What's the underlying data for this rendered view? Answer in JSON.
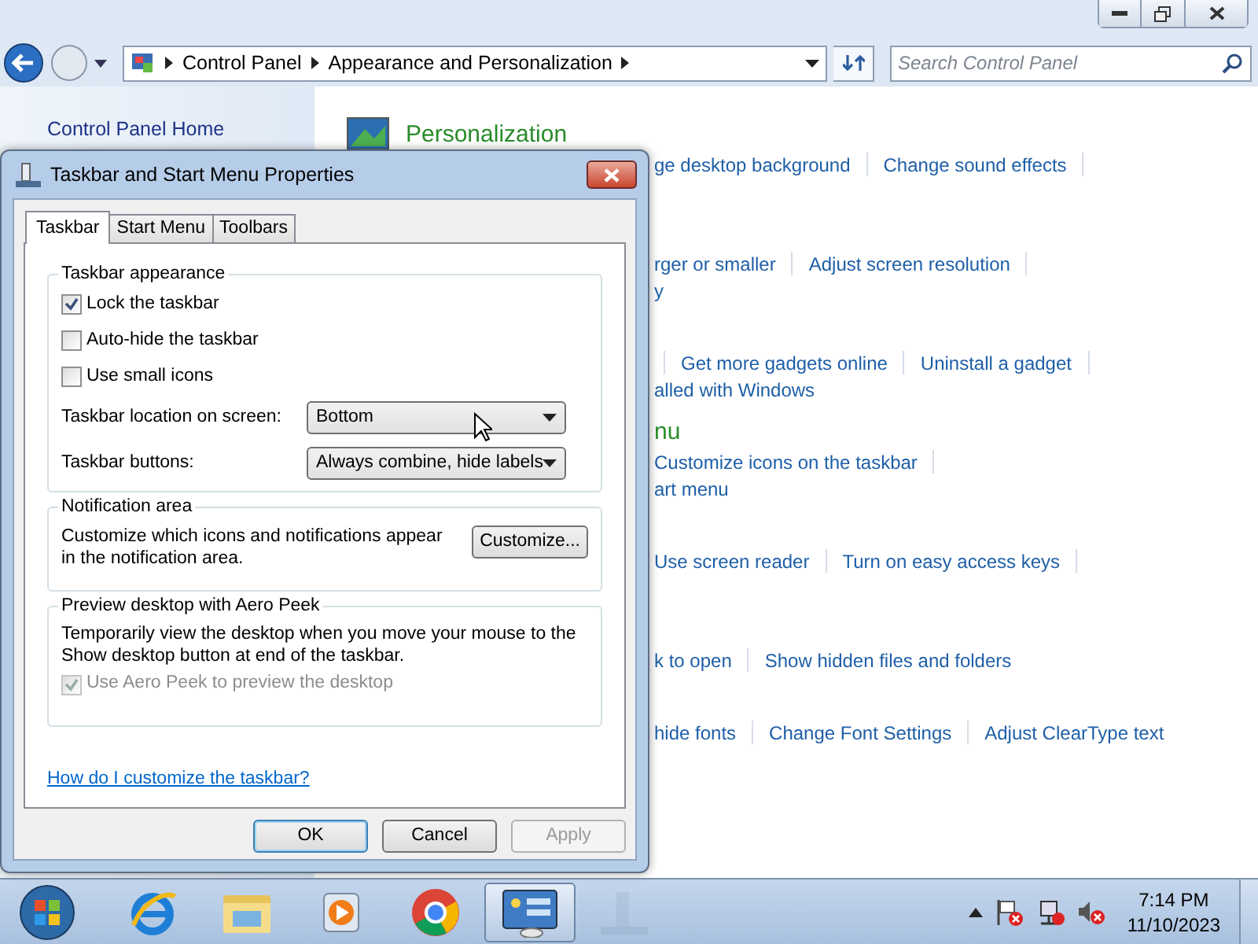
{
  "address_bar": {
    "breadcrumbs": [
      "Control Panel",
      "Appearance and Personalization"
    ]
  },
  "search": {
    "placeholder": "Search Control Panel"
  },
  "sidebar": {
    "items": [
      {
        "label": "Control Panel Home"
      }
    ]
  },
  "content": {
    "sections": [
      {
        "heading": "Personalization",
        "kind": "icon-heading",
        "lines": [
          {
            "links": [
              "ge desktop background",
              "Change sound effects"
            ],
            "lead_sep": false,
            "trailing_sep": true
          }
        ]
      },
      {
        "kind": "plain",
        "lines": [
          {
            "links": [
              "rger or smaller",
              "Adjust screen resolution"
            ],
            "lead_sep": false,
            "trailing_sep": true
          },
          {
            "links": [
              "y"
            ],
            "lead_sep": false,
            "trailing_sep": false
          }
        ]
      },
      {
        "kind": "plain",
        "lines": [
          {
            "links": [
              "Get more gadgets online",
              "Uninstall a gadget"
            ],
            "lead_sep": true,
            "trailing_sep": true
          },
          {
            "links": [
              "alled with Windows"
            ],
            "lead_sep": false,
            "trailing_sep": false
          }
        ]
      },
      {
        "heading": "nu",
        "kind": "plain",
        "lines": [
          {
            "links": [
              "Customize icons on the taskbar"
            ],
            "lead_sep": false,
            "trailing_sep": true
          },
          {
            "links": [
              "art menu"
            ],
            "lead_sep": false,
            "trailing_sep": false
          }
        ]
      },
      {
        "kind": "plain",
        "lines": [
          {
            "links": [
              "Use screen reader",
              "Turn on easy access keys"
            ],
            "lead_sep": false,
            "trailing_sep": true
          }
        ]
      },
      {
        "kind": "short",
        "lines": [
          {
            "links": [
              "k to open",
              "Show hidden files and folders"
            ],
            "lead_sep": false,
            "trailing_sep": false
          }
        ]
      },
      {
        "kind": "plain",
        "lines": [
          {
            "links": [
              "hide fonts",
              "Change Font Settings",
              "Adjust ClearType text"
            ],
            "lead_sep": false,
            "trailing_sep": false
          }
        ]
      }
    ]
  },
  "dialog": {
    "title": "Taskbar and Start Menu Properties",
    "tabs": [
      {
        "label": "Taskbar",
        "selected": true
      },
      {
        "label": "Start Menu",
        "selected": false
      },
      {
        "label": "Toolbars",
        "selected": false
      }
    ],
    "appearance": {
      "title": "Taskbar appearance",
      "options": [
        {
          "label": "Lock the taskbar",
          "checked": true
        },
        {
          "label": "Auto-hide the taskbar",
          "checked": false
        },
        {
          "label": "Use small icons",
          "checked": false
        }
      ],
      "selects": [
        {
          "label": "Taskbar location on screen:",
          "value": "Bottom"
        },
        {
          "label": "Taskbar buttons:",
          "value": "Always combine, hide labels"
        }
      ]
    },
    "notification": {
      "title": "Notification area",
      "text": "Customize which icons and notifications appear in the notification area.",
      "button": "Customize..."
    },
    "peek": {
      "title": "Preview desktop with Aero Peek",
      "text": "Temporarily view the desktop when you move your mouse to the Show desktop button at end of the taskbar.",
      "option": {
        "label": "Use Aero Peek to preview the desktop",
        "checked": true,
        "disabled": true
      }
    },
    "help_link": "How do I customize the taskbar?",
    "buttons": [
      {
        "label": "OK",
        "default": true,
        "disabled": false
      },
      {
        "label": "Cancel",
        "default": false,
        "disabled": false
      },
      {
        "label": "Apply",
        "default": false,
        "disabled": true
      }
    ]
  },
  "taskbar": {
    "apps": [
      {
        "kind": "browser",
        "active": false
      },
      {
        "kind": "folder",
        "active": false
      },
      {
        "kind": "media",
        "active": false
      },
      {
        "kind": "chrome",
        "active": false
      },
      {
        "kind": "panel",
        "active": true
      },
      {
        "kind": "ghost",
        "active": false
      }
    ],
    "clock": {
      "time": "7:14 PM",
      "date": "11/10/2023"
    }
  }
}
